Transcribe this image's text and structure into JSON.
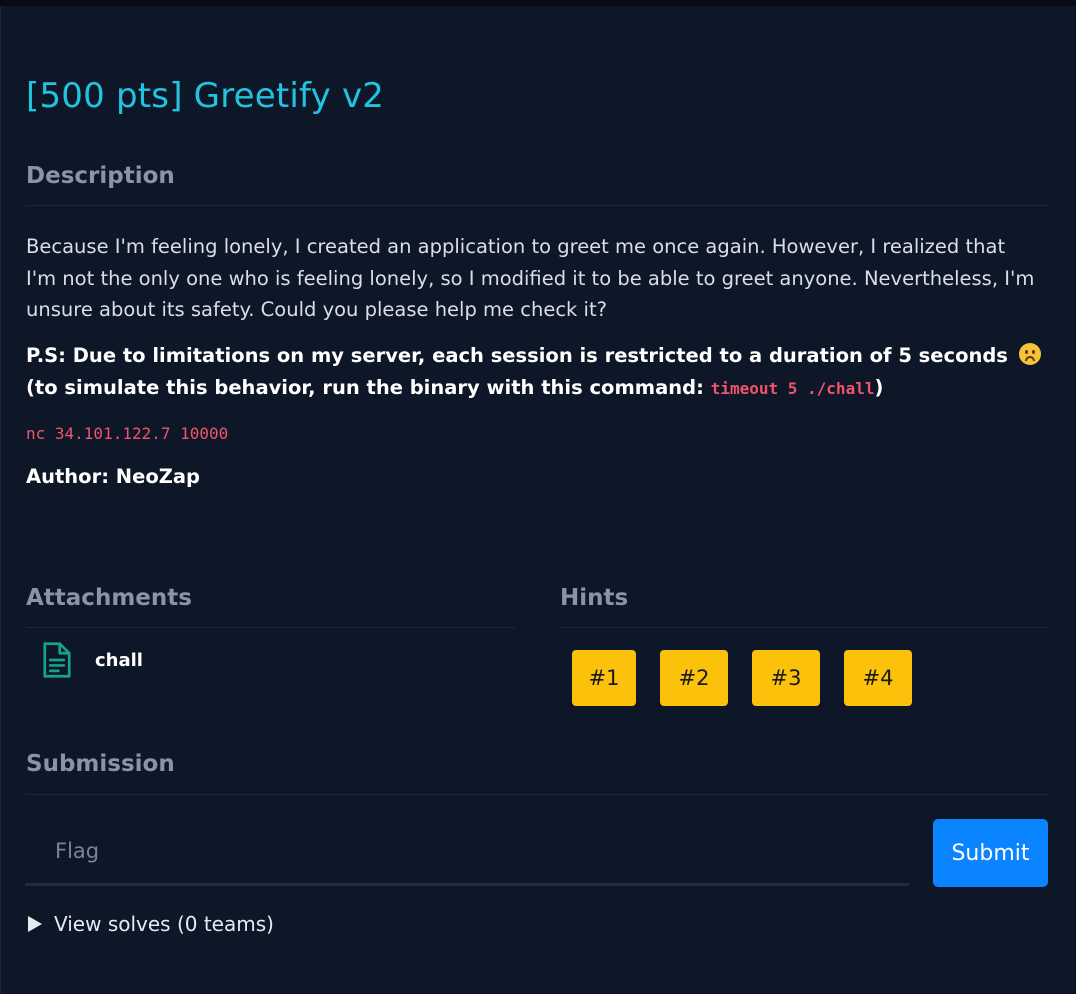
{
  "challenge": {
    "title": "[500 pts] Greetify v2"
  },
  "description": {
    "heading": "Description",
    "body": "Because I'm feeling lonely, I created an application to greet me once again. However, I realized that I'm not the only one who is feeling lonely, so I modified it to be able to greet anyone. Nevertheless, I'm unsure about its safety. Could you please help me check it?",
    "ps_text": "P.S: Due to limitations on my server, each session is restricted to a duration of 5 seconds",
    "ps_simulate_prefix": "(to simulate this behavior, run the binary with this command:",
    "ps_command": "timeout 5 ./chall",
    "ps_suffix": ")",
    "connection": "nc 34.101.122.7 10000",
    "author": "Author: NeoZap"
  },
  "attachments": {
    "heading": "Attachments",
    "files": [
      {
        "name": "chall",
        "icon": "file-text-icon"
      }
    ]
  },
  "hints": {
    "heading": "Hints",
    "items": [
      "#1",
      "#2",
      "#3",
      "#4"
    ]
  },
  "submission": {
    "heading": "Submission",
    "placeholder": "Flag",
    "submit_label": "Submit",
    "solves_label": "View solves (0 teams)"
  },
  "colors": {
    "title": "#22c3e0",
    "hint_button": "#fcc10b",
    "submit_button": "#0a84ff",
    "code": "#f0536b",
    "attachment_icon": "#14a38b"
  }
}
